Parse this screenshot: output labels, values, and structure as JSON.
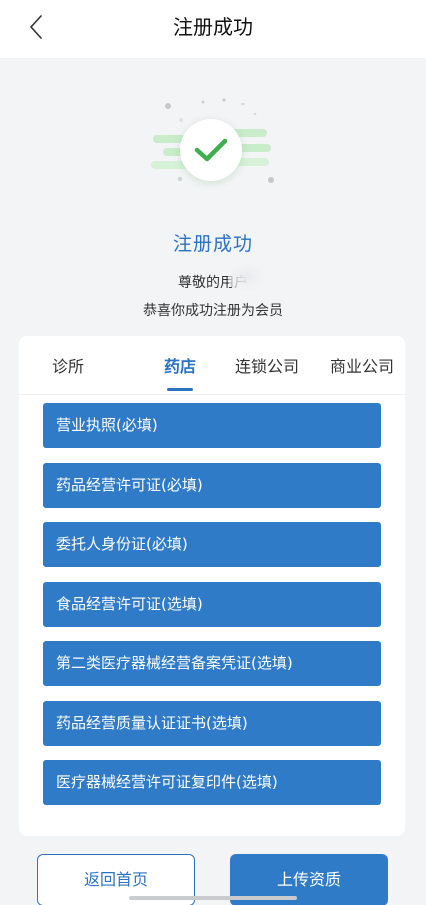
{
  "header": {
    "title": "注册成功",
    "back_icon": "chevron-left-icon"
  },
  "success": {
    "title": "注册成功",
    "greeting": "尊敬的用户",
    "message": "恭喜你成功注册为会员",
    "icon": "check-circle-icon",
    "accent_color": "#2b73c2",
    "check_color": "#3fae4c"
  },
  "tabs": [
    {
      "label": "诊所",
      "active": false
    },
    {
      "label": "药店",
      "active": true
    },
    {
      "label": "连锁公司",
      "active": false
    },
    {
      "label": "商业公司",
      "active": false
    }
  ],
  "documents": [
    {
      "label": "营业执照(必填)"
    },
    {
      "label": "药品经营许可证(必填)"
    },
    {
      "label": "委托人身份证(必填)"
    },
    {
      "label": "食品经营许可证(选填)"
    },
    {
      "label": "第二类医疗器械经营备案凭证(选填)"
    },
    {
      "label": "药品经营质量认证证书(选填)"
    },
    {
      "label": "医疗器械经营许可证复印件(选填)"
    }
  ],
  "actions": {
    "home_label": "返回首页",
    "upload_label": "上传资质"
  },
  "colors": {
    "primary": "#2f7bc7",
    "background": "#f3f4f6"
  }
}
